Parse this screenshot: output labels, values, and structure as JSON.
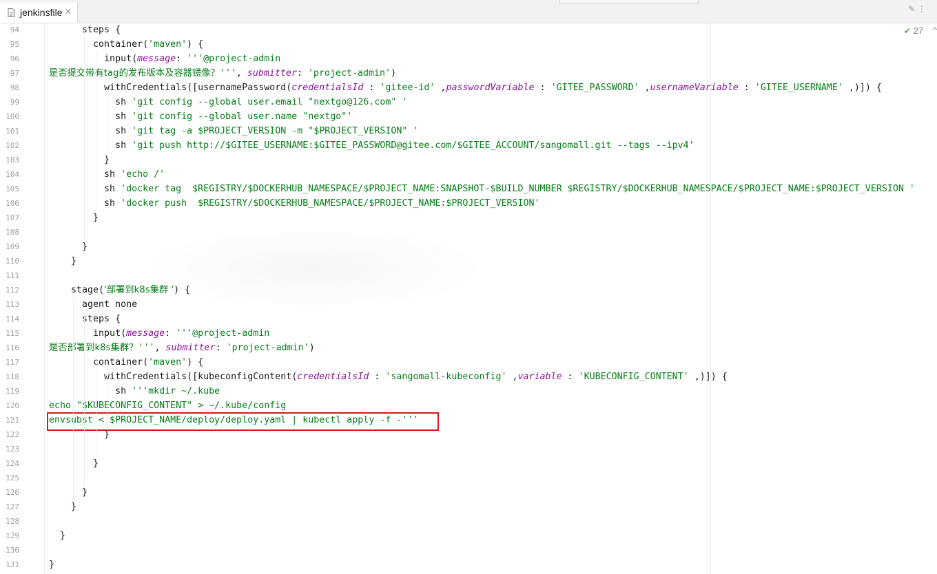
{
  "tab": {
    "filename": "jenkinsfile",
    "icon": "file-icon",
    "close_glyph": "✕"
  },
  "top_icons": "✎ ⋮",
  "inspection": {
    "icon": "checkmark-icon",
    "check_glyph": "✔",
    "count": "27",
    "chevron": "^"
  },
  "editor": {
    "colors": {
      "string": "#067d17",
      "parameter": "#871094",
      "line_number": "#a0a0a0",
      "highlight_box": "#e0141a"
    },
    "lines": [
      {
        "n": "94",
        "segs": [
          {
            "t": "      steps {"
          }
        ]
      },
      {
        "n": "95",
        "segs": [
          {
            "t": "        container("
          },
          {
            "t": "'maven'",
            "c": "str"
          },
          {
            "t": ") {"
          }
        ]
      },
      {
        "n": "96",
        "segs": [
          {
            "t": "          input("
          },
          {
            "t": "message",
            "c": "prm"
          },
          {
            "t": ": "
          },
          {
            "t": "'''@project-admin",
            "c": "str"
          }
        ]
      },
      {
        "n": "97",
        "segs": [
          {
            "t": "是否提交带有tag的发布版本及容器镜像？",
            "c": "str cjk"
          },
          {
            "t": "'''",
            "c": "str"
          },
          {
            "t": ", "
          },
          {
            "t": "submitter",
            "c": "prm"
          },
          {
            "t": ": "
          },
          {
            "t": "'project-admin'",
            "c": "str"
          },
          {
            "t": ")"
          }
        ]
      },
      {
        "n": "98",
        "segs": [
          {
            "t": "          withCredentials([usernamePassword("
          },
          {
            "t": "credentialsId",
            "c": "prm"
          },
          {
            "t": " : "
          },
          {
            "t": "'gitee-id'",
            "c": "str"
          },
          {
            "t": " ,"
          },
          {
            "t": "passwordVariable",
            "c": "prm"
          },
          {
            "t": " : "
          },
          {
            "t": "'GITEE_PASSWORD'",
            "c": "str"
          },
          {
            "t": " ,"
          },
          {
            "t": "usernameVariable",
            "c": "prm"
          },
          {
            "t": " : "
          },
          {
            "t": "'GITEE_USERNAME'",
            "c": "str"
          },
          {
            "t": " ,)]) {"
          }
        ]
      },
      {
        "n": "99",
        "segs": [
          {
            "t": "            sh "
          },
          {
            "t": "'git config --global user.email \"nextgo@126.com\" '",
            "c": "str"
          }
        ]
      },
      {
        "n": "100",
        "segs": [
          {
            "t": "            sh "
          },
          {
            "t": "'git config --global user.name \"nextgo\"'",
            "c": "str"
          }
        ]
      },
      {
        "n": "101",
        "segs": [
          {
            "t": "            sh "
          },
          {
            "t": "'git tag -a $PROJECT_VERSION -m \"$PROJECT_VERSION\" '",
            "c": "str"
          }
        ]
      },
      {
        "n": "102",
        "segs": [
          {
            "t": "            sh "
          },
          {
            "t": "'git push http://$GITEE_USERNAME:$GITEE_PASSWORD@gitee.com/$GITEE_ACCOUNT/sangomall.git --tags --ipv4'",
            "c": "str"
          }
        ]
      },
      {
        "n": "103",
        "segs": [
          {
            "t": "          }"
          }
        ]
      },
      {
        "n": "104",
        "segs": [
          {
            "t": "          sh "
          },
          {
            "t": "'echo /'",
            "c": "str"
          }
        ]
      },
      {
        "n": "105",
        "segs": [
          {
            "t": "          sh "
          },
          {
            "t": "'docker tag  $REGISTRY/$DOCKERHUB_NAMESPACE/$PROJECT_NAME:SNAPSHOT-$BUILD_NUMBER $REGISTRY/$DOCKERHUB_NAMESPACE/$PROJECT_NAME:$PROJECT_VERSION '",
            "c": "str"
          }
        ]
      },
      {
        "n": "106",
        "segs": [
          {
            "t": "          sh "
          },
          {
            "t": "'docker push  $REGISTRY/$DOCKERHUB_NAMESPACE/$PROJECT_NAME:$PROJECT_VERSION'",
            "c": "str"
          }
        ]
      },
      {
        "n": "107",
        "segs": [
          {
            "t": "        }"
          }
        ]
      },
      {
        "n": "108",
        "segs": [
          {
            "t": ""
          }
        ]
      },
      {
        "n": "109",
        "segs": [
          {
            "t": "      }"
          }
        ]
      },
      {
        "n": "110",
        "segs": [
          {
            "t": "    }"
          }
        ]
      },
      {
        "n": "111",
        "segs": [
          {
            "t": ""
          }
        ]
      },
      {
        "n": "112",
        "segs": [
          {
            "t": "    stage("
          },
          {
            "t": "'部署到k8s集群 '",
            "c": "str cjk"
          },
          {
            "t": ") {"
          }
        ]
      },
      {
        "n": "113",
        "segs": [
          {
            "t": "      agent none"
          }
        ]
      },
      {
        "n": "114",
        "segs": [
          {
            "t": "      steps {"
          }
        ]
      },
      {
        "n": "115",
        "segs": [
          {
            "t": "        input("
          },
          {
            "t": "message",
            "c": "prm"
          },
          {
            "t": ": "
          },
          {
            "t": "'''@project-admin",
            "c": "str"
          }
        ]
      },
      {
        "n": "116",
        "segs": [
          {
            "t": "是否部署到k8s集群？",
            "c": "str cjk"
          },
          {
            "t": "'''",
            "c": "str"
          },
          {
            "t": ", "
          },
          {
            "t": "submitter",
            "c": "prm"
          },
          {
            "t": ": "
          },
          {
            "t": "'project-admin'",
            "c": "str"
          },
          {
            "t": ")"
          }
        ]
      },
      {
        "n": "117",
        "segs": [
          {
            "t": "        container("
          },
          {
            "t": "'maven'",
            "c": "str"
          },
          {
            "t": ") {"
          }
        ]
      },
      {
        "n": "118",
        "segs": [
          {
            "t": "          withCredentials([kubeconfigContent("
          },
          {
            "t": "credentialsId",
            "c": "prm"
          },
          {
            "t": " : "
          },
          {
            "t": "'sangomall-kubeconfig'",
            "c": "str"
          },
          {
            "t": " ,"
          },
          {
            "t": "variable",
            "c": "prm"
          },
          {
            "t": " : "
          },
          {
            "t": "'KUBECONFIG_CONTENT'",
            "c": "str"
          },
          {
            "t": " ,)]) {"
          }
        ]
      },
      {
        "n": "119",
        "segs": [
          {
            "t": "            sh "
          },
          {
            "t": "'''mkdir ~/.kube",
            "c": "str"
          }
        ]
      },
      {
        "n": "120",
        "segs": [
          {
            "t": "echo \"$KUBECONFIG_CONTENT\" > ~/.kube/config",
            "c": "str"
          }
        ]
      },
      {
        "n": "121",
        "segs": [
          {
            "t": "envsubst < $PROJECT_NAME/deploy/deploy.yaml | kubectl apply -f -'''",
            "c": "str"
          }
        ]
      },
      {
        "n": "122",
        "segs": [
          {
            "t": "          }"
          }
        ]
      },
      {
        "n": "123",
        "segs": [
          {
            "t": ""
          }
        ]
      },
      {
        "n": "124",
        "segs": [
          {
            "t": "        }"
          }
        ]
      },
      {
        "n": "125",
        "segs": [
          {
            "t": ""
          }
        ]
      },
      {
        "n": "126",
        "segs": [
          {
            "t": "      }"
          }
        ]
      },
      {
        "n": "127",
        "segs": [
          {
            "t": "    }"
          }
        ]
      },
      {
        "n": "128",
        "segs": [
          {
            "t": ""
          }
        ]
      },
      {
        "n": "129",
        "segs": [
          {
            "t": "  }"
          }
        ]
      },
      {
        "n": "130",
        "segs": [
          {
            "t": ""
          }
        ]
      },
      {
        "n": "131",
        "segs": [
          {
            "t": "}"
          }
        ]
      }
    ]
  }
}
